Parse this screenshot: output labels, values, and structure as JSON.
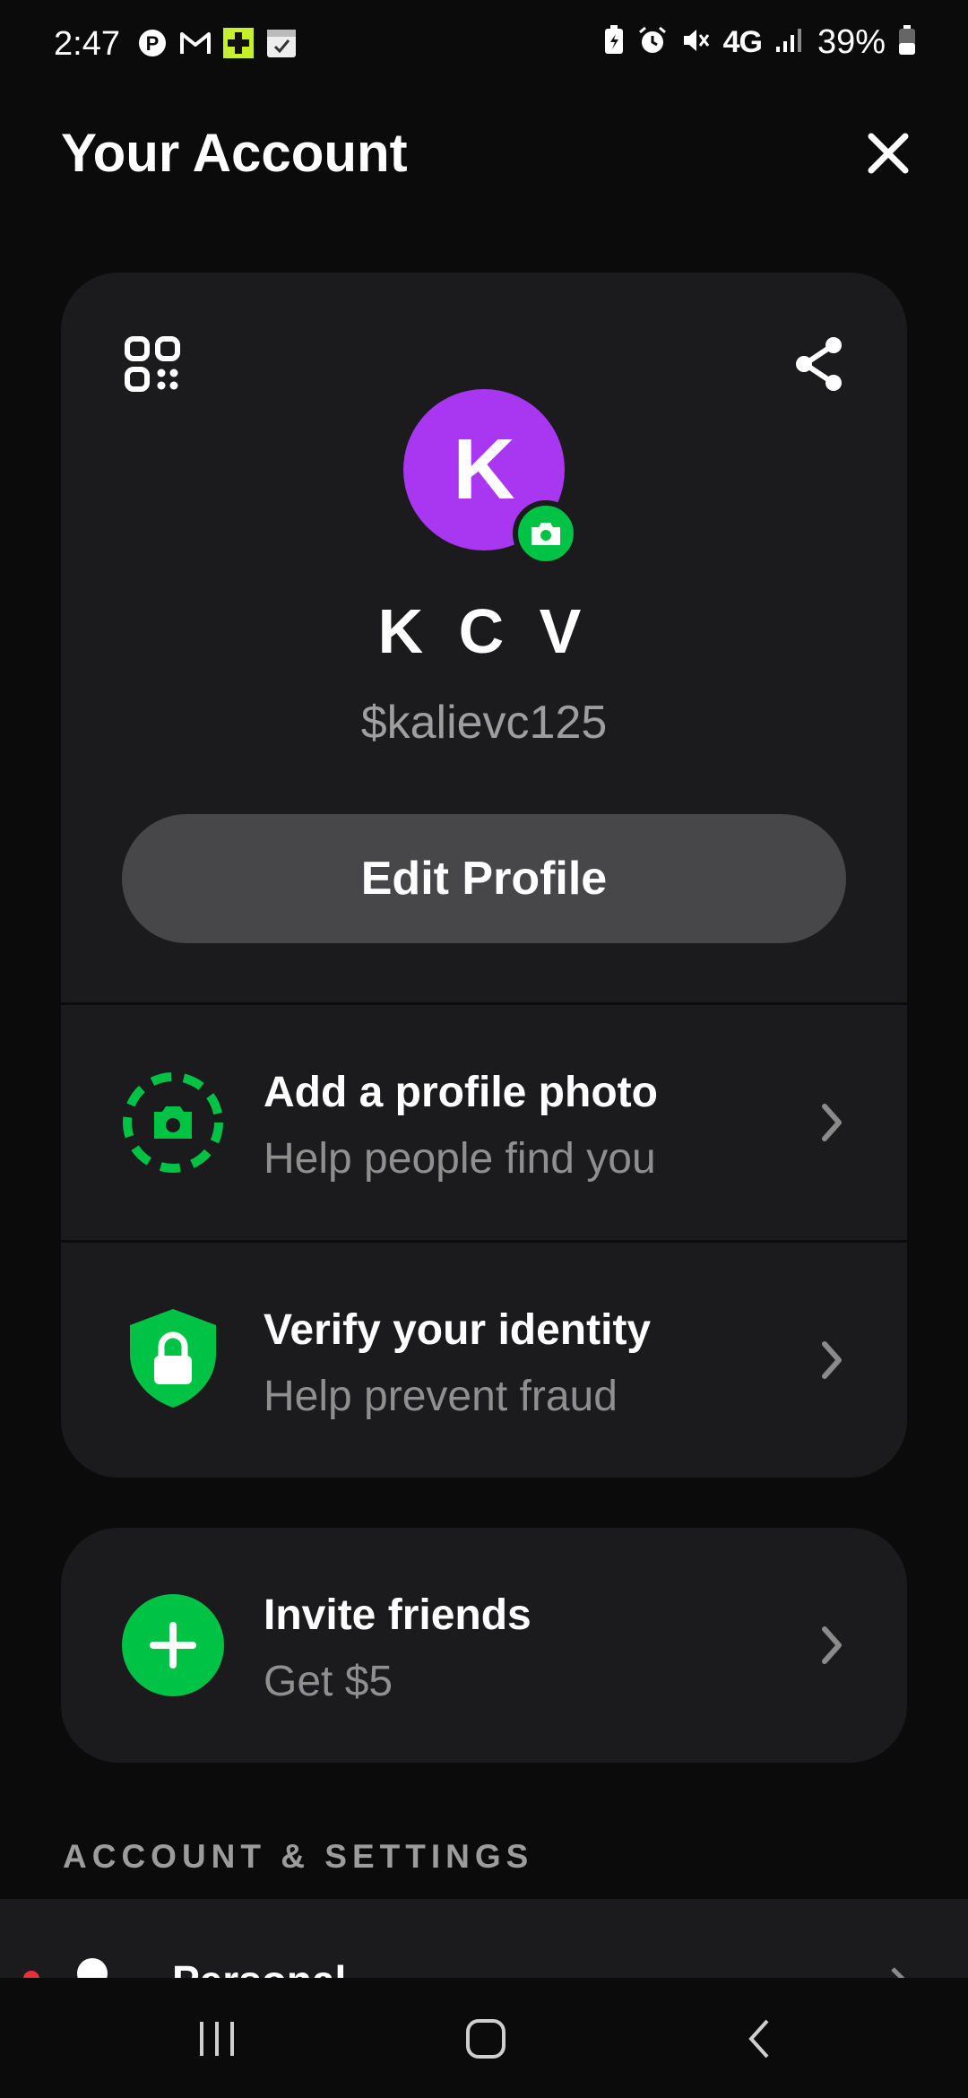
{
  "status_bar": {
    "time": "2:47",
    "network": "4G",
    "battery": "39%",
    "left_icons": [
      "pinterest-icon",
      "gmail-icon",
      "news-app-icon",
      "calendar-check-icon"
    ],
    "right_icons": [
      "battery-saver-icon",
      "alarm-icon",
      "mute-icon",
      "signal-icon",
      "battery-icon"
    ]
  },
  "header": {
    "title": "Your Account",
    "close_icon": "close-icon"
  },
  "profile": {
    "avatar_initial": "K",
    "avatar_color": "#a937f2",
    "name": "K C V",
    "cashtag": "$kalievc125",
    "edit_button": "Edit Profile",
    "qr_icon": "qr-code-icon",
    "share_icon": "share-icon"
  },
  "actions": [
    {
      "title": "Add a profile photo",
      "subtitle": "Help people find you",
      "icon": "dashed-camera-icon"
    },
    {
      "title": "Verify your identity",
      "subtitle": "Help prevent fraud",
      "icon": "shield-lock-icon"
    }
  ],
  "invite": {
    "title": "Invite friends",
    "subtitle": "Get $5",
    "icon": "plus-icon"
  },
  "section_label": "ACCOUNT & SETTINGS",
  "list_peek": {
    "label": "Personal"
  },
  "colors": {
    "accent_green": "#00c244",
    "background": "#0b0b0c",
    "card": "#1b1b1d"
  }
}
